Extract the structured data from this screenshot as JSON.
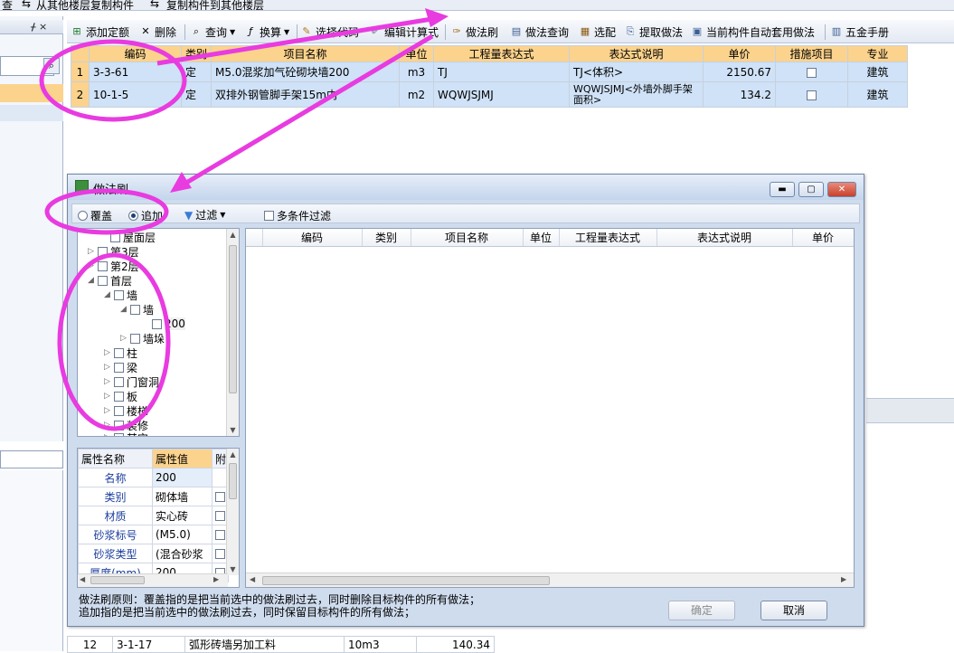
{
  "topbar": {
    "items": [
      "查",
      "从其他楼层复制构件",
      "复制构件到其他楼层"
    ]
  },
  "left_panels": {
    "panel1_pin": "ᚋ ×",
    "panel2_pin": "ᚋ ×"
  },
  "toolbar": {
    "items": [
      {
        "label": "添加定额",
        "icon": "add-quota-icon"
      },
      {
        "label": "删除",
        "icon": "delete-icon"
      },
      {
        "label": "查询",
        "icon": "search-icon",
        "dropdown": true
      },
      {
        "label": "换算",
        "icon": "convert-icon",
        "dropdown": true
      },
      {
        "label": "选择代码",
        "icon": "select-code-icon"
      },
      {
        "label": "编辑计算式",
        "icon": "edit-formula-icon"
      },
      {
        "label": "做法刷",
        "icon": "brush-icon"
      },
      {
        "label": "做法查询",
        "icon": "method-search-icon"
      },
      {
        "label": "选配",
        "icon": "select-config-icon"
      },
      {
        "label": "提取做法",
        "icon": "extract-method-icon"
      },
      {
        "label": "当前构件自动套用做法",
        "icon": "auto-apply-icon"
      },
      {
        "label": "五金手册",
        "icon": "handbook-icon"
      }
    ]
  },
  "quota_grid": {
    "headers": [
      "编码",
      "类别",
      "项目名称",
      "单位",
      "工程量表达式",
      "表达式说明",
      "单价",
      "措施项目",
      "专业"
    ],
    "rows": [
      {
        "num": "1",
        "code": "3-3-61",
        "type": "定",
        "name": "M5.0混浆加气砼砌块墙200",
        "unit": "m3",
        "expr": "TJ",
        "desc": "TJ<体积>",
        "price": "2150.67",
        "measure": false,
        "major": "建筑"
      },
      {
        "num": "2",
        "code": "10-1-5",
        "type": "定",
        "name": "双排外钢管脚手架15m内",
        "unit": "m2",
        "expr": "WQWJSJMJ",
        "desc": "WQWJSJMJ<外墙外脚手架面积>",
        "price": "134.2",
        "measure": false,
        "major": "建筑"
      }
    ]
  },
  "dialog": {
    "title": "做法刷",
    "window_buttons": [
      "▬",
      "▢",
      "✕"
    ],
    "options": {
      "overwrite": "覆盖",
      "append": "追加",
      "selected": "append",
      "filter": "过滤",
      "multi_filter": "多条件过滤"
    },
    "tree": [
      {
        "label": "屋面层",
        "level": 1,
        "expand": ""
      },
      {
        "label": "第3层",
        "level": 1,
        "expand": "▷"
      },
      {
        "label": "第2层",
        "level": 1,
        "expand": "▷"
      },
      {
        "label": "首层",
        "level": 1,
        "expand": "◢"
      },
      {
        "label": "墙",
        "level": 2,
        "expand": "◢"
      },
      {
        "label": "墙",
        "level": 3,
        "expand": "◢"
      },
      {
        "label": "200",
        "level": 4,
        "expand": ""
      },
      {
        "label": "墙垛",
        "level": 3,
        "expand": "▷"
      },
      {
        "label": "柱",
        "level": 2,
        "expand": "▷"
      },
      {
        "label": "梁",
        "level": 2,
        "expand": "▷"
      },
      {
        "label": "门窗洞",
        "level": 2,
        "expand": "▷"
      },
      {
        "label": "板",
        "level": 2,
        "expand": "▷"
      },
      {
        "label": "楼梯",
        "level": 2,
        "expand": "▷"
      },
      {
        "label": "装修",
        "level": 2,
        "expand": "▷"
      },
      {
        "label": "其它",
        "level": 2,
        "expand": "▷"
      }
    ],
    "props": {
      "headers": [
        "属性名称",
        "属性值",
        "附"
      ],
      "rows": [
        {
          "name": "名称",
          "value": "200"
        },
        {
          "name": "类别",
          "value": "砌体墙"
        },
        {
          "name": "材质",
          "value": "实心砖"
        },
        {
          "name": "砂浆标号",
          "value": "(M5.0)"
        },
        {
          "name": "砂浆类型",
          "value": "(混合砂浆"
        },
        {
          "name": "厚度(mm)",
          "value": "200"
        }
      ]
    },
    "list_headers": [
      "编码",
      "类别",
      "项目名称",
      "单位",
      "工程量表达式",
      "表达式说明",
      "单价"
    ],
    "note_line1": "做法刷原则：覆盖指的是把当前选中的做法刷过去，同时删除目标构件的所有做法；",
    "note_line2": "追加指的是把当前选中的做法刷过去，同时保留目标构件的所有做法；",
    "ok_label": "确定",
    "cancel_label": "取消"
  },
  "bottom_row": {
    "num": "12",
    "code": "3-1-17",
    "name": "弧形砖墙另加工料",
    "unit": "10m3",
    "value": "140.34"
  },
  "annotation_color": "#e83be0"
}
